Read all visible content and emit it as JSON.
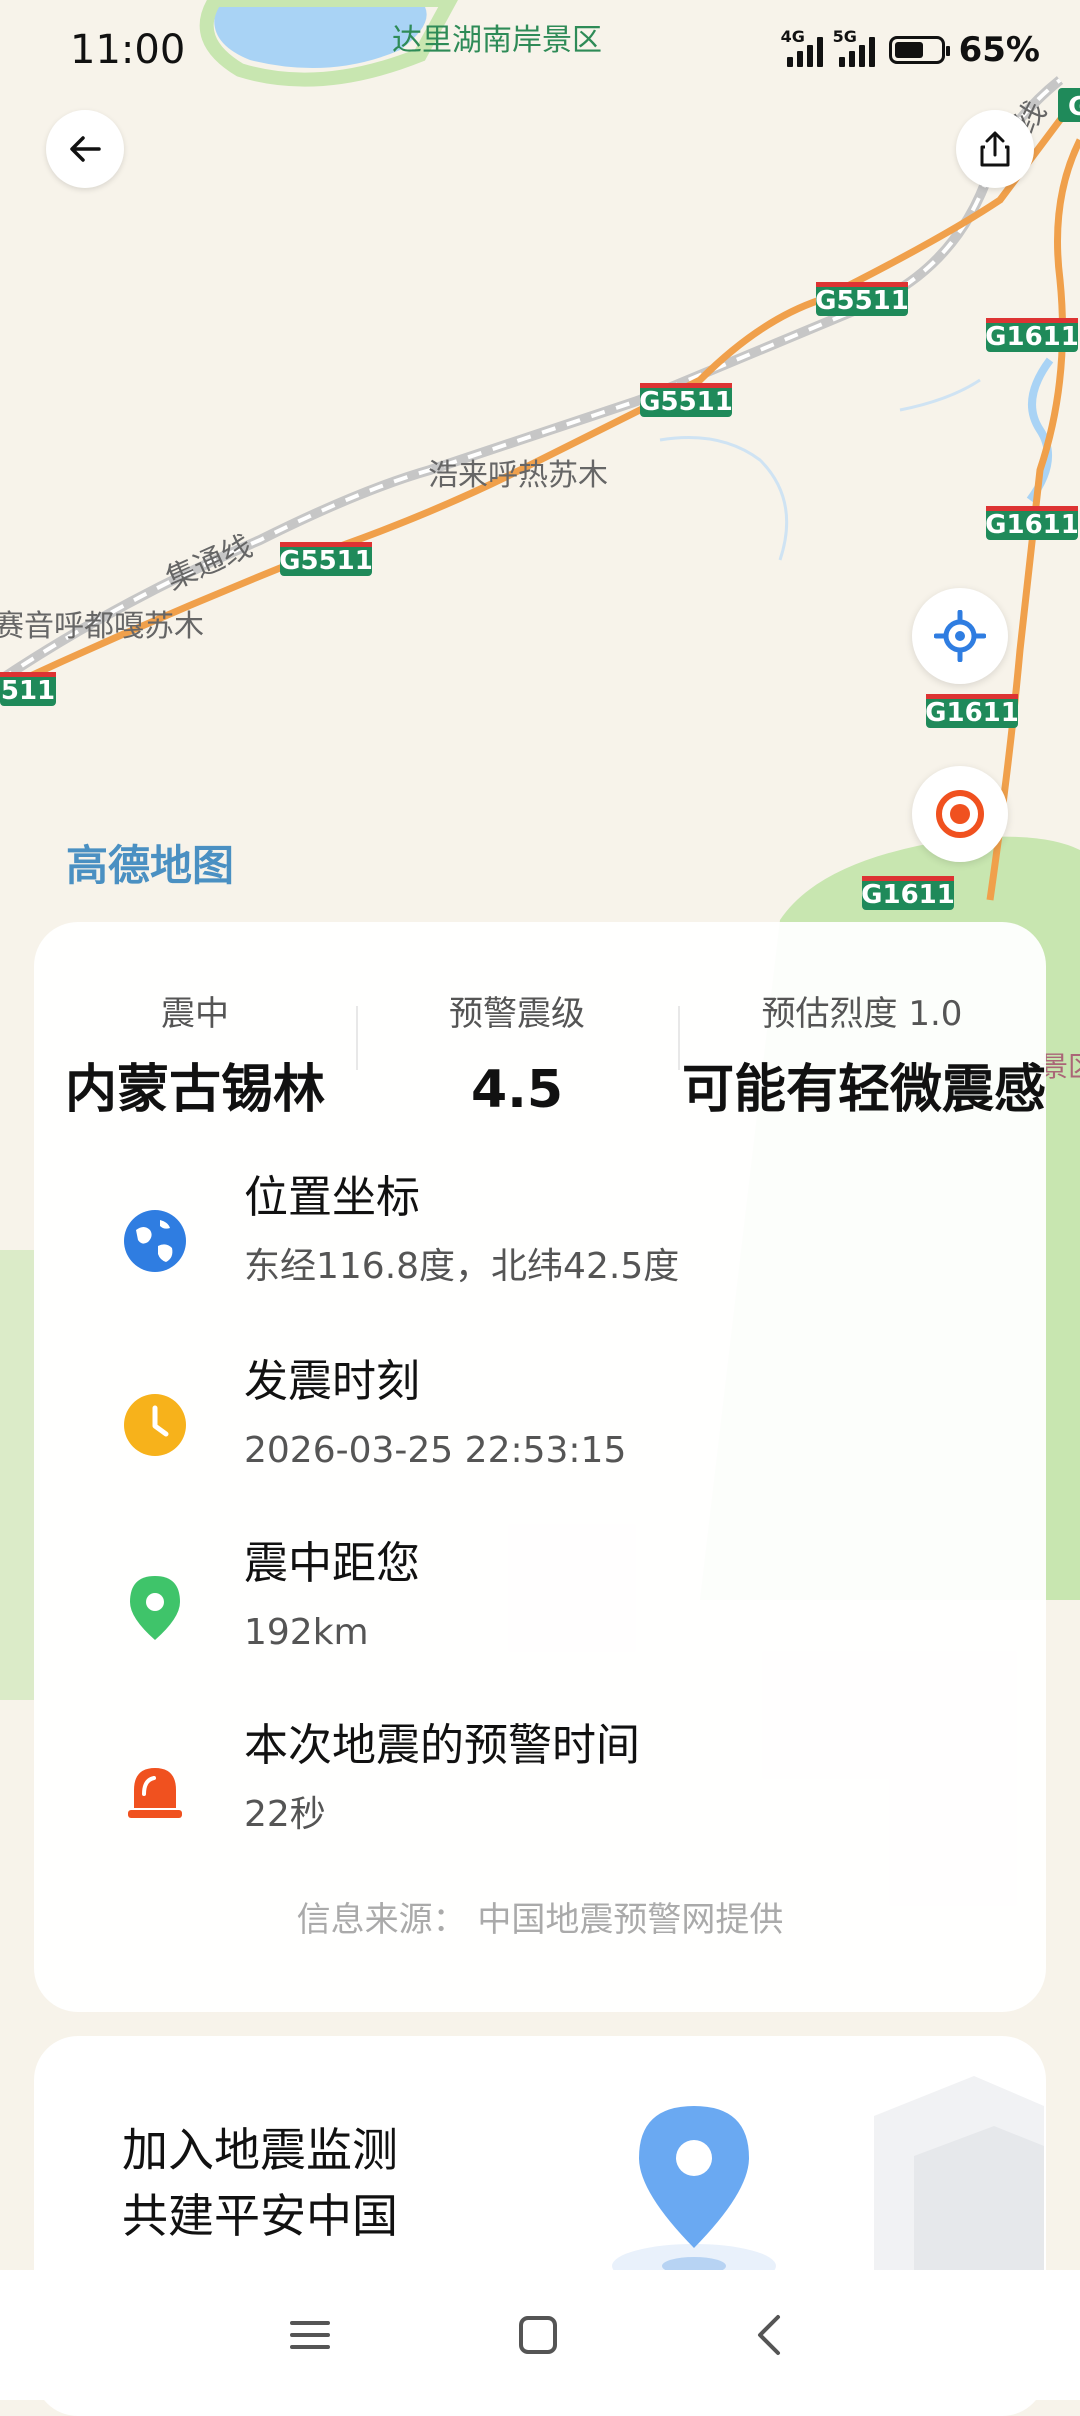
{
  "status_bar": {
    "time": "11:00",
    "signal_1_label": "4G",
    "signal_2_label": "5G",
    "battery": "65%",
    "battery_level": 0.65
  },
  "map": {
    "labels": {
      "scenic_area": "达里湖南岸景区",
      "town_1": "浩来呼热苏木",
      "town_2": "赛音呼都嘎苏木",
      "railway": "集通线",
      "railway_2": "线",
      "brand": "高德地图",
      "edge_label": "景区"
    },
    "roads": [
      "G5511",
      "G5511",
      "G5511",
      "511",
      "G1611",
      "G1611",
      "G1611",
      "G1611",
      "G"
    ],
    "colors": {
      "land": "#f7f3ea",
      "water": "#a9d3f5",
      "green": "#c8e6b0",
      "highway": "#f0a04b",
      "shield": "#1f8a5a"
    }
  },
  "earthquake": {
    "epicenter_label": "震中",
    "epicenter_value": "内蒙古锡林",
    "magnitude_label": "预警震级",
    "magnitude_value": "4.5",
    "intensity_label": "预估烈度 1.0",
    "intensity_value": "可能有轻微震感",
    "rows": [
      {
        "title": "位置坐标",
        "value": "东经116.8度，北纬42.5度",
        "icon": "globe-icon",
        "color": "#2f7de1"
      },
      {
        "title": "发震时刻",
        "value": "2026-03-25 22:53:15",
        "icon": "clock-icon",
        "color": "#f7b21b"
      },
      {
        "title": "震中距您",
        "value": "192km",
        "icon": "location-pin-icon",
        "color": "#3fc46a"
      },
      {
        "title": "本次地震的预警时间",
        "value": "22秒",
        "icon": "alarm-icon",
        "color": "#f0511f"
      }
    ],
    "source": "信息来源：  中国地震预警网提供"
  },
  "promo": {
    "line1": "加入地震监测",
    "line2": "共建平安中国"
  },
  "nav": {
    "menu": "menu-icon",
    "home": "home-icon",
    "back": "back-icon"
  }
}
